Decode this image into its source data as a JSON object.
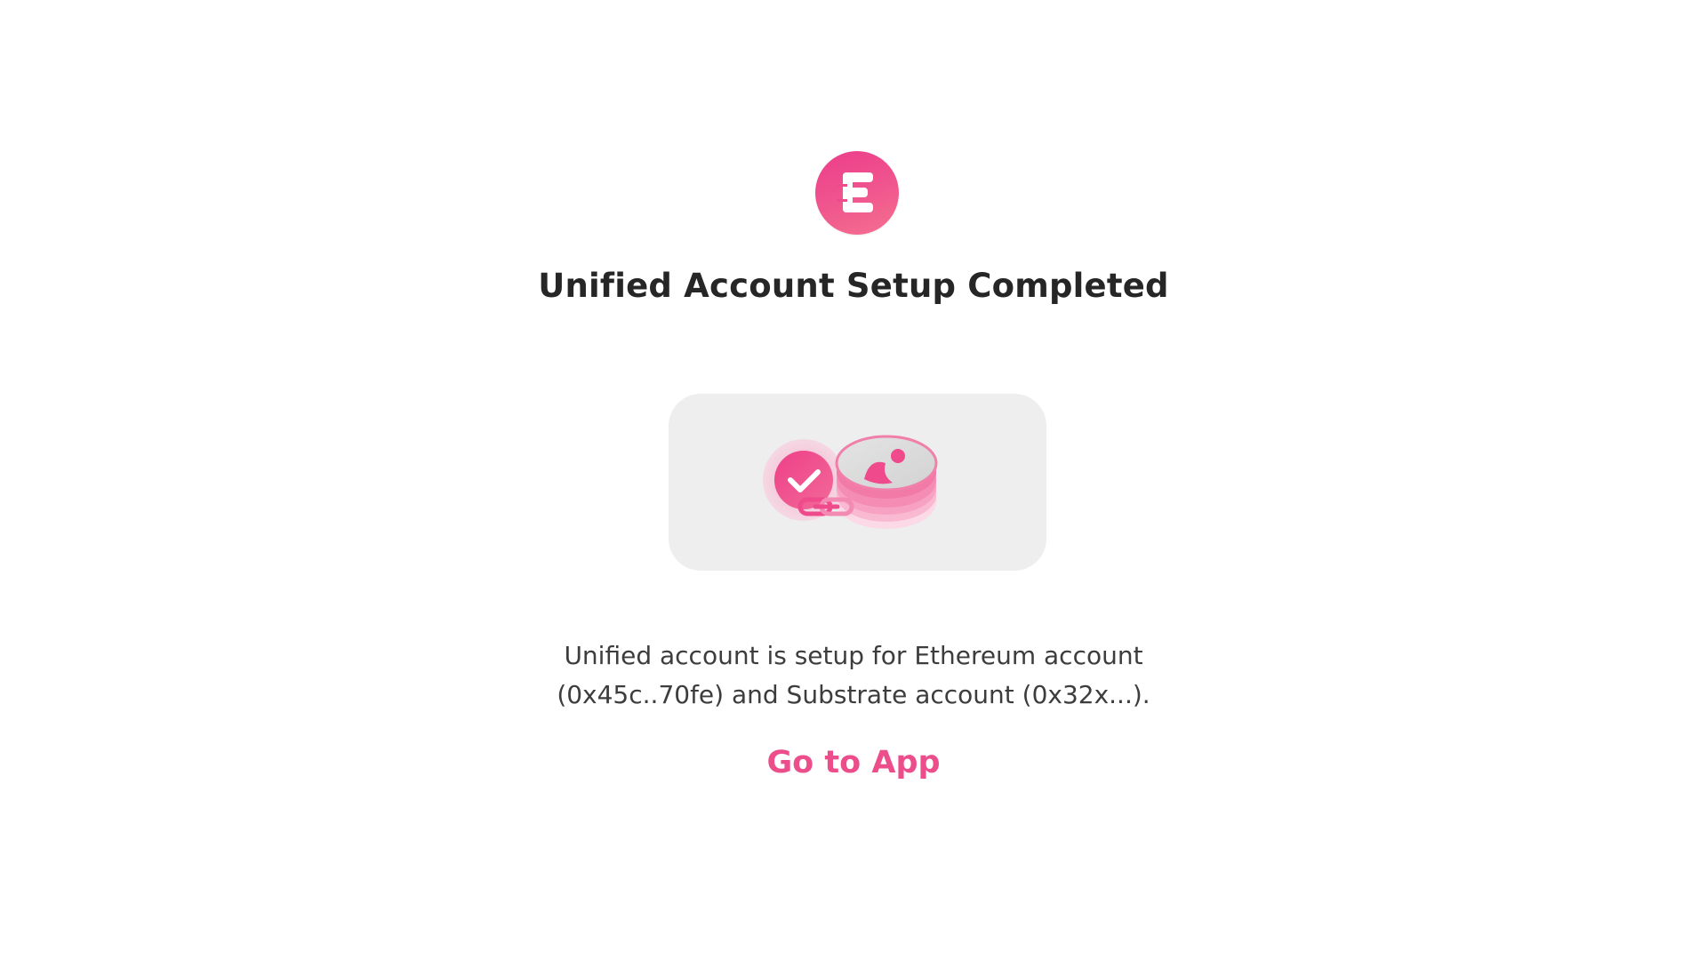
{
  "app": {
    "logo_icon": "energy-web-e-logo-icon",
    "brand_color": "#ec4d8b"
  },
  "header": {
    "title": "Unified Account Setup Completed"
  },
  "illustration": {
    "icon": "linked-accounts-check-icon"
  },
  "message": {
    "line1": "Unified account is setup for Ethereum account",
    "line2": "(0x45c..70fe) and Substrate account (0x32x...)."
  },
  "actions": {
    "go_to_app_label": "Go to App"
  }
}
